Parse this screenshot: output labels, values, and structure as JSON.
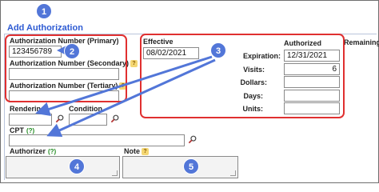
{
  "section": {
    "title": "Add Authorization"
  },
  "fields": {
    "auth_primary_label": "Authorization Number (Primary)",
    "auth_primary_value": "123456789",
    "auth_secondary_label": "Authorization Number (Secondary)",
    "auth_secondary_value": "",
    "auth_tertiary_label": "Authorization Number (Tertiary)",
    "auth_tertiary_value": "",
    "rendering_label": "Rendering",
    "rendering_value": "",
    "condition_label": "Condition",
    "condition_value": "",
    "cpt_label": "CPT",
    "cpt_help": "(?)",
    "cpt_value": "",
    "authorizer_label": "Authorizer",
    "authorizer_help": "(?)",
    "note_label": "Note"
  },
  "effective": {
    "label": "Effective",
    "value": "08/02/2021"
  },
  "authorized": {
    "header": "Authorized",
    "remaining_header": "Remaining",
    "expiration_label": "Expiration:",
    "expiration_value": "12/31/2021",
    "visits_label": "Visits:",
    "visits_value": "6",
    "dollars_label": "Dollars:",
    "dollars_value": "",
    "days_label": "Days:",
    "days_value": "",
    "units_label": "Units:",
    "units_value": ""
  },
  "callouts": [
    "1",
    "2",
    "3",
    "4",
    "5"
  ],
  "colors": {
    "callout": "#5276d8",
    "highlight": "#e03030",
    "section_title": "#2e5bd3",
    "help_icon": "#f4d774",
    "help_green": "#1f8a1f"
  },
  "icons": [
    "help-icon",
    "search-icon",
    "resize-grip-icon"
  ]
}
